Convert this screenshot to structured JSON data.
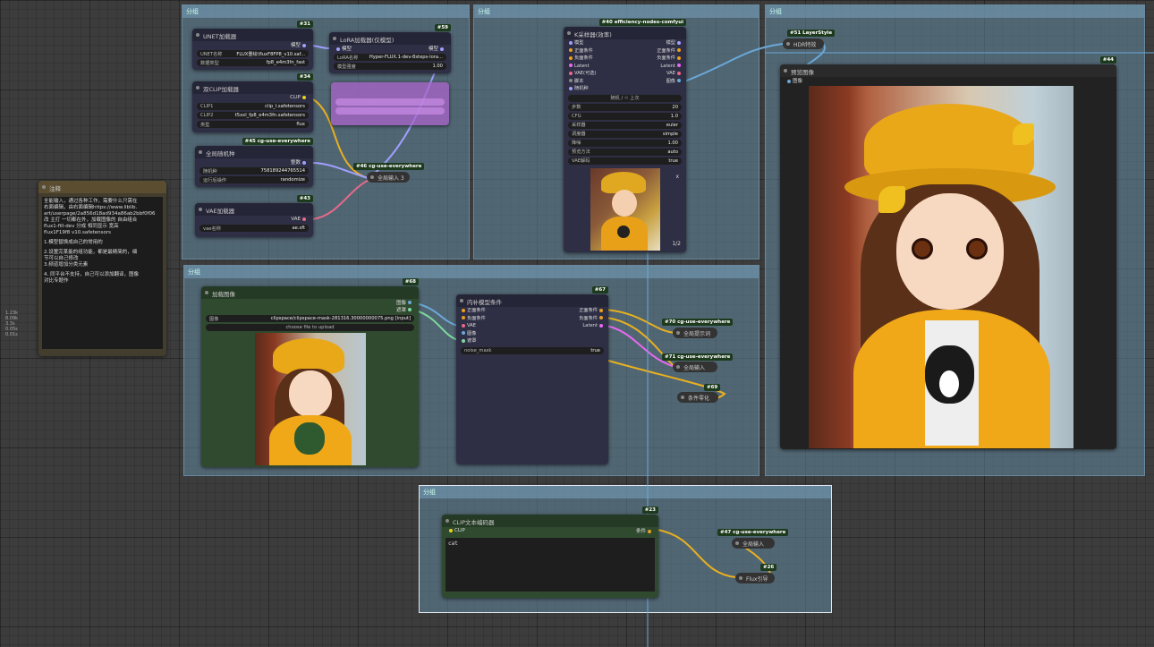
{
  "groups": {
    "g1": "分组",
    "g2": "分组",
    "g3": "分组",
    "g4": "分组",
    "g5": "分组"
  },
  "note": {
    "title": "注释",
    "lines": [
      "全能输入，通过各种工作，需要什么只需在",
      "右面编辑，由右面编辑https://www.liblib.",
      "art/userpage/2a856d18ad934a86ab2bbf0f06",
      "改 主打 一切都在外，加载图像的 自由组合",
      "flux1-fill-dev 分成 相同显示 宽高",
      "flux1F19f8 v10.safetensors",
      "",
      "1.模型替换成自己的常用的",
      "",
      "2.设置完某能的组功能，都是最精简的，细",
      "节可以自己修改",
      "3.频道增加分类元素",
      "",
      "4. 同平台不支持，自己可以添加翻译，图像",
      "对比专题作"
    ]
  },
  "sidelabels": [
    "1.23k",
    "8.09k",
    "3.3s",
    "0.05s",
    "0.01s"
  ],
  "unet": {
    "badge": "#31",
    "title": "UNET加载器",
    "out": "模型",
    "w1l": "UNET名称",
    "w1v": "FLUX重绘\\fluxF8FP8_v10.saf...",
    "w2l": "数据类型",
    "w2v": "fp8_e4m3fn_fast"
  },
  "lora": {
    "badge": "#59",
    "title": "LoRA加载器(仅模型)",
    "in": "模型",
    "out": "模型",
    "w1l": "LoRA名称",
    "w1v": "Hyper-FLUX.1-dev-8steps-lora...",
    "w2l": "模型强度",
    "w2v": "1.00"
  },
  "clip": {
    "badge": "#34",
    "title": "双CLIP加载器",
    "out": "CLIP",
    "w1l": "CLIP1",
    "w1v": "clip_l.safetensors",
    "w2l": "CLIP2",
    "w2v": "t5xxl_fp8_e4m3fn.safetensors",
    "w3l": "类型",
    "w3v": "flux"
  },
  "seed": {
    "badge": "#45 cg-use-everywhere",
    "title": "全局随机种",
    "out": "整数",
    "w1l": "随机种",
    "w1v": "758189244765514",
    "w2l": "运行后操作",
    "w2v": "randomize"
  },
  "vae": {
    "badge": "#43",
    "title": "VAE加载器",
    "out": "VAE",
    "w1l": "vae名称",
    "w1v": "ae.sft"
  },
  "anywhere46": {
    "tag": "#46 cg-use-everywhere",
    "label": "全局输入 3"
  },
  "ksampler": {
    "badge": "#40 efficiency-nodes-comfyui",
    "title": "K采样器(效率)",
    "ins": [
      "模型",
      "正面条件",
      "负面条件",
      "Latent",
      "VAE(可选)",
      "脚本"
    ],
    "outs": [
      "模型",
      "正面条件",
      "负面条件",
      "Latent",
      "VAE",
      "图像"
    ],
    "seedlabel": "随机种",
    "seedbtn": "随机 / ♲ 上次",
    "widgets": [
      {
        "l": "步数",
        "v": "20"
      },
      {
        "l": "CFG",
        "v": "1.0"
      },
      {
        "l": "采样器",
        "v": "euler"
      },
      {
        "l": "调度器",
        "v": "simple"
      },
      {
        "l": "降噪",
        "v": "1.00"
      },
      {
        "l": "预览方法",
        "v": "auto"
      },
      {
        "l": "VAE解码",
        "v": "true"
      }
    ],
    "counter": "1/2",
    "close": "x"
  },
  "layerstyle": {
    "tag": "#51 LayerStyle",
    "label": "HDR特效"
  },
  "preview": {
    "badge": "#44",
    "title": "预览图像",
    "in": "图像"
  },
  "loadimg": {
    "badge": "#68",
    "title": "加载图像",
    "outs": [
      "图像",
      "遮罩"
    ],
    "w1l": "图像",
    "w1v": "clipspace/clipspace-mask-281316.30000000075.png [input]",
    "upload": "choose file to upload"
  },
  "inpaint": {
    "badge": "#67",
    "title": "内补模型条件",
    "ins": [
      "正面条件",
      "负面条件",
      "VAE",
      "图像",
      "遮罩"
    ],
    "outs": [
      "正面条件",
      "负面条件",
      "Latent"
    ],
    "w1l": "noise_mask",
    "w1v": "true"
  },
  "anywhere70": {
    "tag": "#70 cg-use-everywhere",
    "label": "全局提示词"
  },
  "anywhere71": {
    "tag": "#71 cg-use-everywhere",
    "label": "全局输入"
  },
  "cond69": {
    "tag": "#69",
    "label": "条件零化"
  },
  "cliptext": {
    "badge": "#23",
    "title": "CLIP文本编码器",
    "in": "CLIP",
    "out": "条件",
    "text": "cat"
  },
  "anywhere47": {
    "tag": "#47 cg-use-everywhere",
    "label": "全局输入"
  },
  "flux26": {
    "tag": "#26",
    "label": "Flux引导"
  },
  "colors": {
    "group": "#6288a0",
    "wire_yellow": "#e8b020",
    "wire_blue": "#6aa8d8",
    "wire_pink": "#e86a8a",
    "wire_lav": "#a0a0ff",
    "node_green": "#2f4a2f"
  }
}
